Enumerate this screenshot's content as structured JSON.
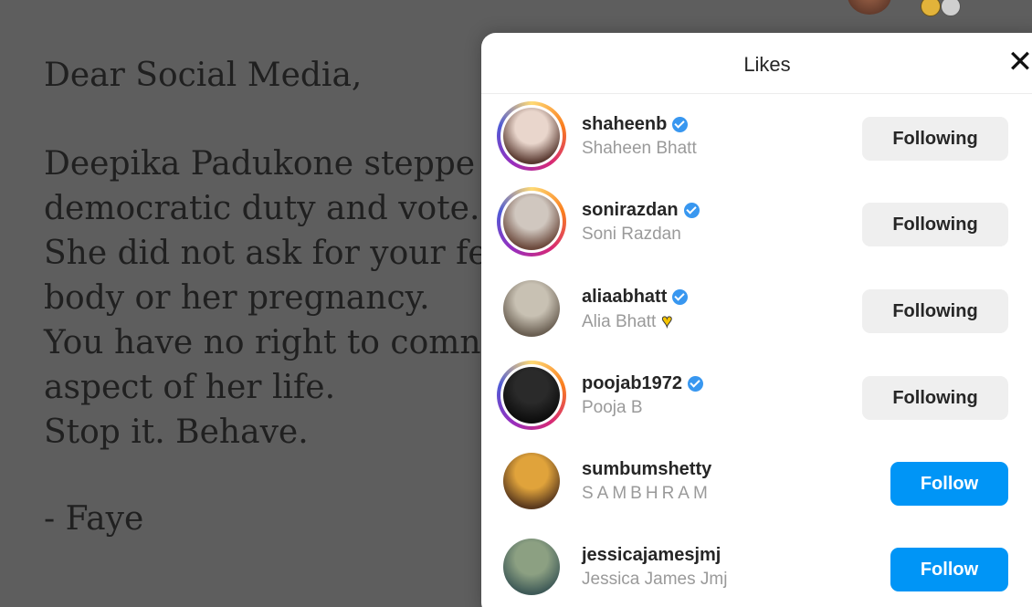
{
  "post": {
    "greeting": "Dear Social Media,",
    "lines": [
      "Deepika Padukone steppe",
      "democratic duty and vote.",
      "She did not ask for your fe",
      "body or her pregnancy.",
      "You have no right to comn",
      "aspect of her life.",
      "Stop it. Behave."
    ],
    "signature": "- Faye"
  },
  "modal": {
    "title": "Likes",
    "close_symbol": "✕",
    "users": [
      {
        "username": "shaheenb",
        "full_name": "Shaheen Bhatt",
        "verified": true,
        "button": "Following",
        "story_ring": true,
        "avatar_colors": [
          "#e9d6cc",
          "#5a3a31"
        ]
      },
      {
        "username": "sonirazdan",
        "full_name": "Soni Razdan",
        "verified": true,
        "button": "Following",
        "story_ring": true,
        "avatar_colors": [
          "#d0c7bf",
          "#6d4b3e"
        ]
      },
      {
        "username": "aliaabhatt",
        "full_name": "Alia Bhatt",
        "verified": true,
        "button": "Following",
        "story_ring": false,
        "avatar_colors": [
          "#c8c1b3",
          "#6a5f52"
        ],
        "extra_icon": "yellow-heart-icon"
      },
      {
        "username": "poojab1972",
        "full_name": "Pooja B",
        "verified": true,
        "button": "Following",
        "story_ring": true,
        "avatar_colors": [
          "#2a2a2a",
          "#0d0d0d"
        ]
      },
      {
        "username": "sumbumshetty",
        "full_name": "SAMBHRAM",
        "verified": false,
        "button": "Follow",
        "story_ring": false,
        "avatar_colors": [
          "#e0a33b",
          "#5b3a1e"
        ]
      },
      {
        "username": "jessicajamesjmj",
        "full_name": "Jessica James Jmj",
        "verified": false,
        "button": "Follow",
        "story_ring": false,
        "avatar_colors": [
          "#8ca082",
          "#3f5a57"
        ]
      }
    ]
  },
  "colors": {
    "follow_blue": "#0095f6",
    "verified_blue": "#3897f0",
    "backdrop": "#5e5e5e"
  }
}
